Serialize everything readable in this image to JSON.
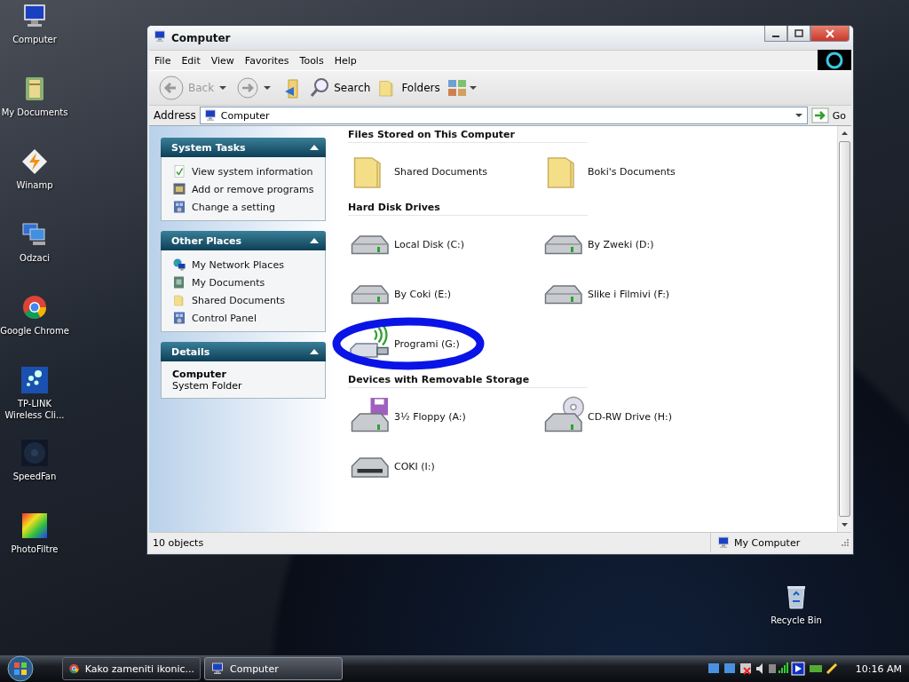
{
  "desktop_icons": [
    {
      "label": "Computer",
      "kind": "computer"
    },
    {
      "label": "My Documents",
      "kind": "documents"
    },
    {
      "label": "Winamp",
      "kind": "winamp"
    },
    {
      "label": "Odzaci",
      "kind": "network"
    },
    {
      "label": "Google Chrome",
      "kind": "chrome"
    },
    {
      "label": "TP-LINK Wireless Cli...",
      "kind": "tplink"
    },
    {
      "label": "SpeedFan",
      "kind": "speedfan"
    },
    {
      "label": "PhotoFiltre",
      "kind": "photofiltre"
    }
  ],
  "recycle_bin": {
    "label": "Recycle Bin"
  },
  "window": {
    "title": "Computer",
    "menu": [
      "File",
      "Edit",
      "View",
      "Favorites",
      "Tools",
      "Help"
    ],
    "toolbar": {
      "back": {
        "label": "Back",
        "disabled": true
      },
      "search": "Search",
      "folders": "Folders"
    },
    "address": {
      "label": "Address",
      "value": "Computer",
      "go": "Go"
    },
    "task_panes": [
      {
        "title": "System Tasks",
        "expanded": true,
        "items": [
          {
            "label": "View system information",
            "kind": "check"
          },
          {
            "label": "Add or remove programs",
            "kind": "programs"
          },
          {
            "label": "Change a setting",
            "kind": "controlpanel"
          }
        ]
      },
      {
        "title": "Other Places",
        "expanded": true,
        "items": [
          {
            "label": "My Network Places",
            "kind": "netplaces"
          },
          {
            "label": "My Documents",
            "kind": "mydocs"
          },
          {
            "label": "Shared Documents",
            "kind": "folder"
          },
          {
            "label": "Control Panel",
            "kind": "controlpanel"
          }
        ]
      }
    ],
    "details": {
      "title": "Details",
      "expanded": true,
      "name": "Computer",
      "type": "System Folder"
    },
    "groups": [
      {
        "title": "Files Stored on This Computer",
        "items": [
          {
            "label": "Shared Documents",
            "kind": "folder",
            "circled": false
          },
          {
            "label": "Boki's Documents",
            "kind": "folder",
            "circled": false
          }
        ]
      },
      {
        "title": "Hard Disk Drives",
        "items": [
          {
            "label": "Local Disk (C:)",
            "kind": "hdd",
            "circled": false
          },
          {
            "label": "By Zweki (D:)",
            "kind": "hdd",
            "circled": false
          },
          {
            "label": "By Coki (E:)",
            "kind": "hdd",
            "circled": false
          },
          {
            "label": "Slike i Filmivi (F:)",
            "kind": "hdd",
            "circled": false
          },
          {
            "label": "Programi (G:)",
            "kind": "usb",
            "circled": true
          }
        ]
      },
      {
        "title": "Devices with Removable Storage",
        "items": [
          {
            "label": "3½ Floppy (A:)",
            "kind": "floppy",
            "circled": false
          },
          {
            "label": "CD-RW Drive (H:)",
            "kind": "cd",
            "circled": false
          },
          {
            "label": "COKI (I:)",
            "kind": "card",
            "circled": false
          }
        ]
      }
    ],
    "status_bar": {
      "count": "10 objects",
      "zone": "My Computer"
    }
  },
  "taskbar": {
    "buttons": [
      {
        "label": "Kako zameniti ikonic...",
        "kind": "chrome",
        "selected": false
      },
      {
        "label": "Computer",
        "kind": "computer",
        "selected": true
      }
    ],
    "clock": "10:16 AM"
  }
}
